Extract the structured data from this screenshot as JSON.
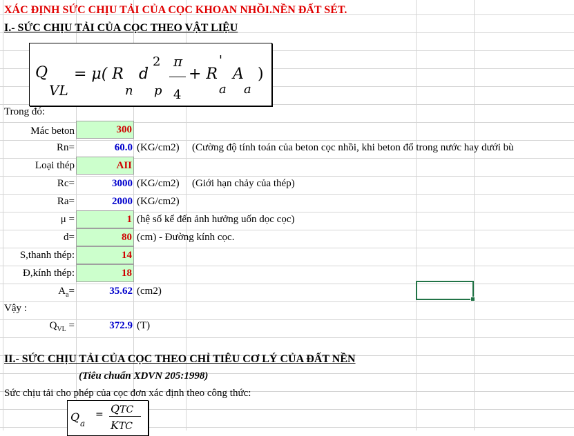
{
  "title": "XÁC ĐỊNH SỨC CHỊU TẢI CỦA CỌC KHOAN NHỒI.NỀN ĐẤT SÉT.",
  "section1": {
    "heading": "I.- SỨC CHỊU TẢI CỦA CỌC THEO VẬT LIỆU",
    "formula": {
      "Q": "Q",
      "VL": "VL",
      "eq": "= μ( R",
      "n": "n",
      "d": "d",
      "sq": "2",
      "p": "p",
      "pi": "π",
      "four": "4",
      "plus": "+ R",
      "prime": "'",
      "a1": "a",
      "A": "A",
      "a2": "a",
      "close": ")"
    },
    "where_label": "Trong đó:",
    "rows": {
      "mac_beton": {
        "label": "Mác beton",
        "value": "300"
      },
      "rn": {
        "label": "Rn=",
        "value": "60.0",
        "unit": "(KG/cm2)",
        "note": "(Cường độ tính toán của beton cọc nhồi, khi beton đổ trong nước hay dưới bù"
      },
      "loai_thep": {
        "label": "Loại thép",
        "value": "AII"
      },
      "rc": {
        "label": "Rc=",
        "value": "3000",
        "unit": "(KG/cm2)",
        "note": "(Giới hạn chảy của thép)"
      },
      "ra": {
        "label": "Ra=",
        "value": "2000",
        "unit": "(KG/cm2)"
      },
      "mu": {
        "label": "μ =",
        "value": "1",
        "note": "(hệ số kể đến ảnh hưởng uốn dọc cọc)"
      },
      "d": {
        "label": "d=",
        "value": "80",
        "note": "(cm) - Đường kính cọc."
      },
      "s_thanh": {
        "label": "S,thanh thép:",
        "value": "14"
      },
      "d_kinh": {
        "label": "Đ,kính thép:",
        "value": "18"
      },
      "aa": {
        "label_main": "A",
        "label_sub": "a",
        "label_tail": "=",
        "value": "35.62",
        "unit": "(cm2)"
      }
    },
    "conclusion_label": "Vậy :",
    "qvl": {
      "label_main": "Q",
      "label_sub": "VL",
      "label_tail": " =",
      "value": "372.9",
      "unit": "(T)"
    }
  },
  "section2": {
    "heading": "II.- SỨC CHỊU TẢI CỦA CỌC THEO CHỈ TIÊU CƠ LÝ CỦA ĐẤT NỀN",
    "standard": "(Tiêu chuẩn XDVN 205:1998)",
    "intro": "Sức chịu tải cho phép của cọc đơn xác định theo công thức:",
    "formula": {
      "Q": "Q",
      "a": "a",
      "eq": "=",
      "num": "Q",
      "num_sub": "TC",
      "den": "K",
      "den_sub": "TC"
    }
  },
  "colors": {
    "input_bg": "#ccffcc",
    "input_text": "#d00000",
    "computed": "#0000cc",
    "title": "#e00000",
    "selection": "#217346"
  }
}
